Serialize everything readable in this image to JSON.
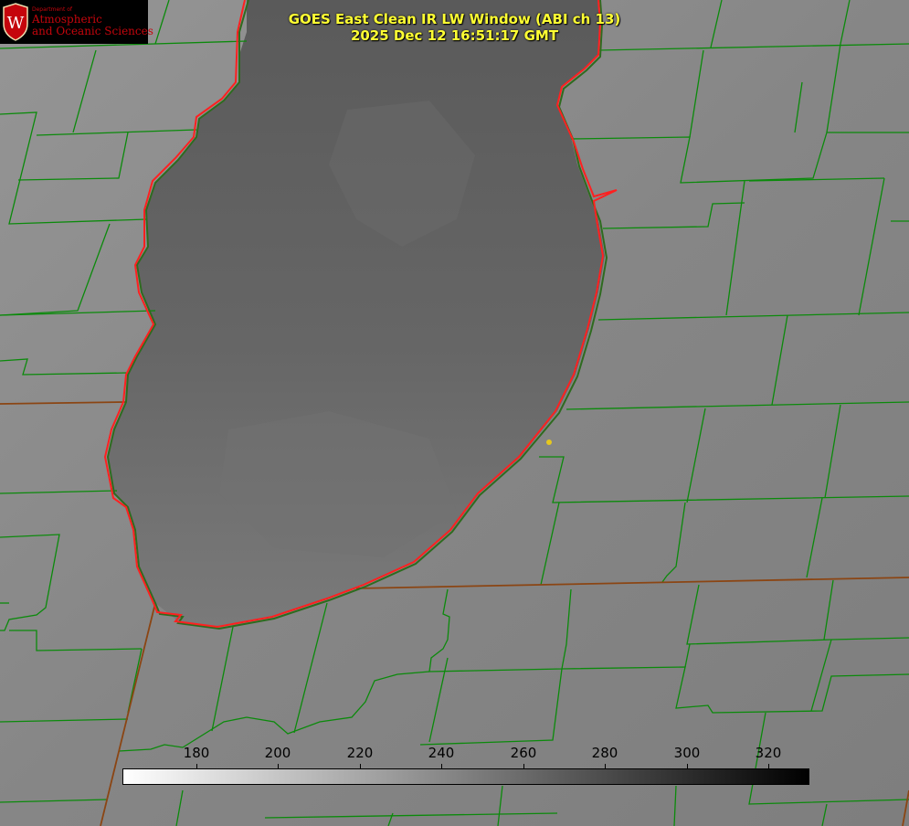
{
  "logo": {
    "dept_label": "Department of",
    "name_line1": "Atmospheric",
    "name_line2": "and Oceanic Sciences",
    "seal_letter": "W",
    "color": "#c5050c"
  },
  "title": {
    "line1": "GOES East Clean IR LW Window (ABI ch 13)",
    "line2": "2025 Dec 12 16:51:17 GMT",
    "color": "#ffff33"
  },
  "colorbar": {
    "ticks": [
      "180",
      "200",
      "220",
      "240",
      "260",
      "280",
      "300",
      "320"
    ],
    "gradient_start": "#ffffff",
    "gradient_end": "#000000"
  },
  "map": {
    "county_line_color": "#0b8a0b",
    "state_line_color": "#8b4513",
    "coastline_color": "#ff2020",
    "marker_color": "#e6c81e",
    "lake_color": "#5e5e5e",
    "land_color": "#8a8a8a"
  }
}
